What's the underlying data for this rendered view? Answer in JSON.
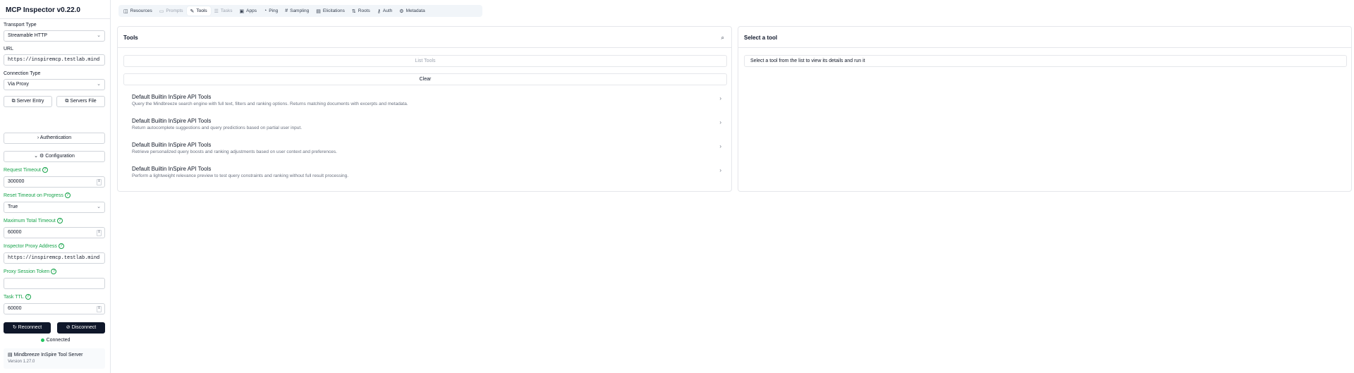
{
  "app": {
    "title": "MCP Inspector v0.22.0"
  },
  "sidebar": {
    "transport_label": "Transport Type",
    "transport_value": "Streamable HTTP",
    "url_label": "URL",
    "url_value": "https://inspiremcp.testlab.mind",
    "connection_label": "Connection Type",
    "connection_value": "Via Proxy",
    "server_entry_label": "Server Entry",
    "servers_file_label": "Servers File",
    "authentication_label": "Authentication",
    "configuration_label": "Configuration",
    "request_timeout_label": "Request Timeout",
    "request_timeout_value": "300000",
    "reset_timeout_label": "Reset Timeout on Progress",
    "reset_timeout_value": "True",
    "max_timeout_label": "Maximum Total Timeout",
    "max_timeout_value": "60000",
    "proxy_address_label": "Inspector Proxy Address",
    "proxy_address_value": "https://inspiremcp.testlab.mind",
    "proxy_token_label": "Proxy Session Token",
    "proxy_token_value": "",
    "task_ttl_label": "Task TTL",
    "task_ttl_value": "60000",
    "reconnect_label": "Reconnect",
    "disconnect_label": "Disconnect",
    "status_text": "Connected",
    "server_name": "Mindbreeze InSpire Tool Server",
    "server_version": "Version 1.27.0"
  },
  "tabs": [
    {
      "label": "Resources",
      "icon": "◫",
      "icon_name": "resources-icon",
      "state": "normal"
    },
    {
      "label": "Prompts",
      "icon": "▭",
      "icon_name": "prompts-icon",
      "state": "disabled"
    },
    {
      "label": "Tools",
      "icon": "✎",
      "icon_name": "tools-icon",
      "state": "active"
    },
    {
      "label": "Tasks",
      "icon": "☰",
      "icon_name": "tasks-icon",
      "state": "disabled"
    },
    {
      "label": "Apps",
      "icon": "▣",
      "icon_name": "apps-icon",
      "state": "normal"
    },
    {
      "label": "Ping",
      "icon": "◔",
      "icon_name": "ping-icon",
      "state": "normal"
    },
    {
      "label": "Sampling",
      "icon": "#",
      "icon_name": "sampling-icon",
      "state": "normal"
    },
    {
      "label": "Elicitations",
      "icon": "▤",
      "icon_name": "elicitations-icon",
      "state": "normal"
    },
    {
      "label": "Roots",
      "icon": "⇅",
      "icon_name": "roots-icon",
      "state": "normal"
    },
    {
      "label": "Auth",
      "icon": "⚷",
      "icon_name": "auth-icon",
      "state": "normal"
    },
    {
      "label": "Metadata",
      "icon": "⚙",
      "icon_name": "metadata-icon",
      "state": "normal"
    }
  ],
  "tools_panel": {
    "title": "Tools",
    "list_tools_label": "List Tools",
    "clear_label": "Clear",
    "items": [
      {
        "name": "Default Builtin InSpire API Tools",
        "description": "Query the Mindbreeze search engine with full text, filters and ranking options. Returns matching documents with excerpts and metadata."
      },
      {
        "name": "Default Builtin InSpire API Tools",
        "description": "Return autocomplete suggestions and query predictions based on partial user input."
      },
      {
        "name": "Default Builtin InSpire API Tools",
        "description": "Retrieve personalized query boosts and ranking adjustments based on user context and preferences."
      },
      {
        "name": "Default Builtin InSpire API Tools",
        "description": "Perform a lightweight relevance preview to test query constraints and ranking without full result processing."
      }
    ]
  },
  "detail_panel": {
    "title": "Select a tool",
    "hint": "Select a tool from the list to view its details and run it"
  },
  "colors": {
    "accent_green": "#16a34a",
    "dark_button": "#0f172a",
    "status_dot": "#22c55e"
  }
}
